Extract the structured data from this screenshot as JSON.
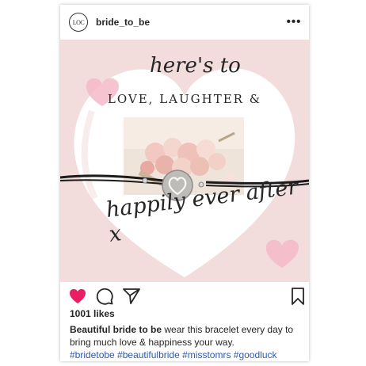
{
  "header": {
    "username": "bride_to_be",
    "avatar_text": "LOC",
    "more_icon": "more-icon"
  },
  "post": {
    "heading_script": "here's to",
    "heading_caps": "LOVE, LAUGHTER &",
    "tagline_script": "happily ever after x"
  },
  "actions": {
    "like_icon": "heart-icon",
    "comment_icon": "comment-icon",
    "share_icon": "send-icon",
    "save_icon": "bookmark-icon"
  },
  "likes": "1001 likes",
  "caption": {
    "author": "Beautiful bride to be",
    "text": "wear this bracelet every day to bring much love & happiness your way.",
    "hashtags": "#bridetobe #beautifulbride #misstomrs #goodluck"
  },
  "colors": {
    "post_background": "#f2dcdc",
    "like": "#e91e63",
    "hashtag": "#2f59a8"
  }
}
